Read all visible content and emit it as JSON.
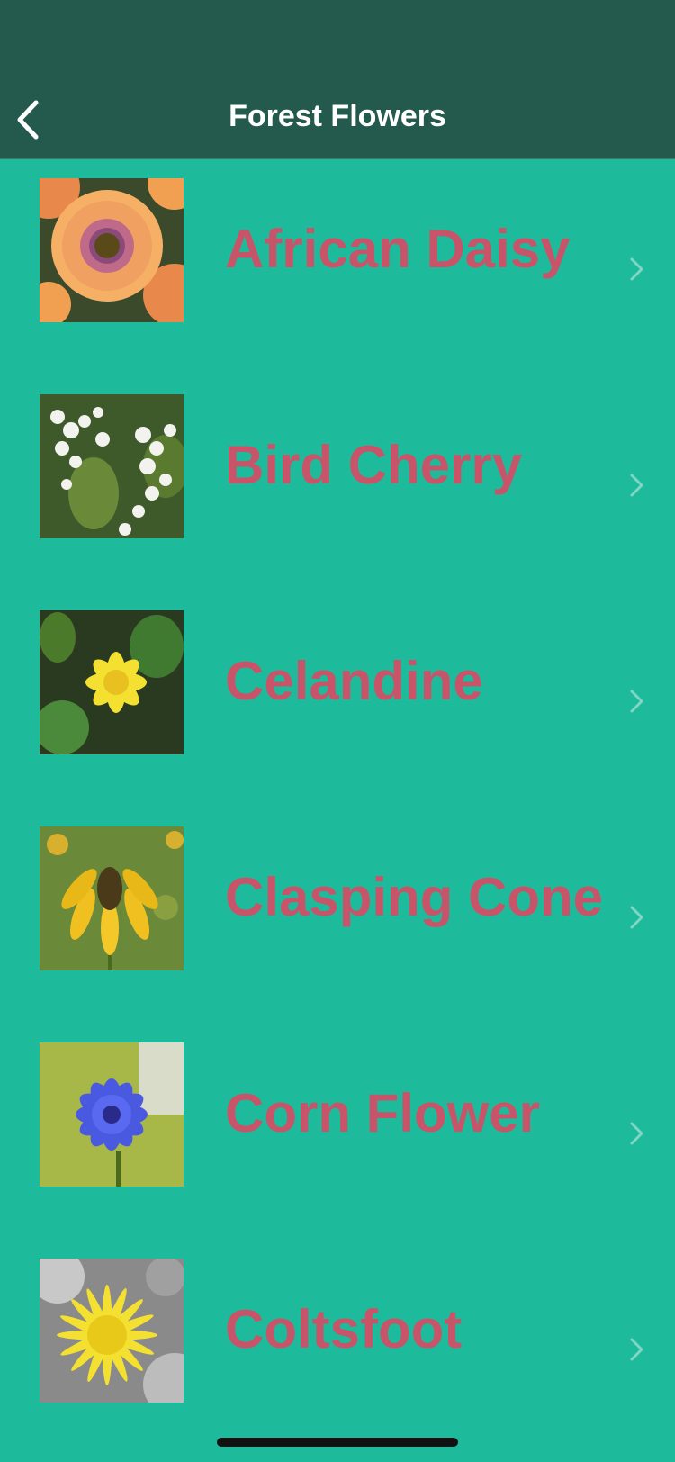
{
  "nav": {
    "title": "Forest Flowers",
    "back_icon": "chevron-left-icon"
  },
  "colors": {
    "background": "#1dbb9c",
    "navbar": "#245a4e",
    "label": "#c8546a",
    "chevron": "#7fd6c4"
  },
  "flowers": [
    {
      "name": "African Daisy",
      "image": "african-daisy-photo"
    },
    {
      "name": "Bird Cherry",
      "image": "bird-cherry-photo"
    },
    {
      "name": "Celandine",
      "image": "celandine-photo"
    },
    {
      "name": "Clasping Cone",
      "image": "clasping-cone-photo"
    },
    {
      "name": "Corn Flower",
      "image": "corn-flower-photo"
    },
    {
      "name": "Coltsfoot",
      "image": "coltsfoot-photo"
    }
  ]
}
